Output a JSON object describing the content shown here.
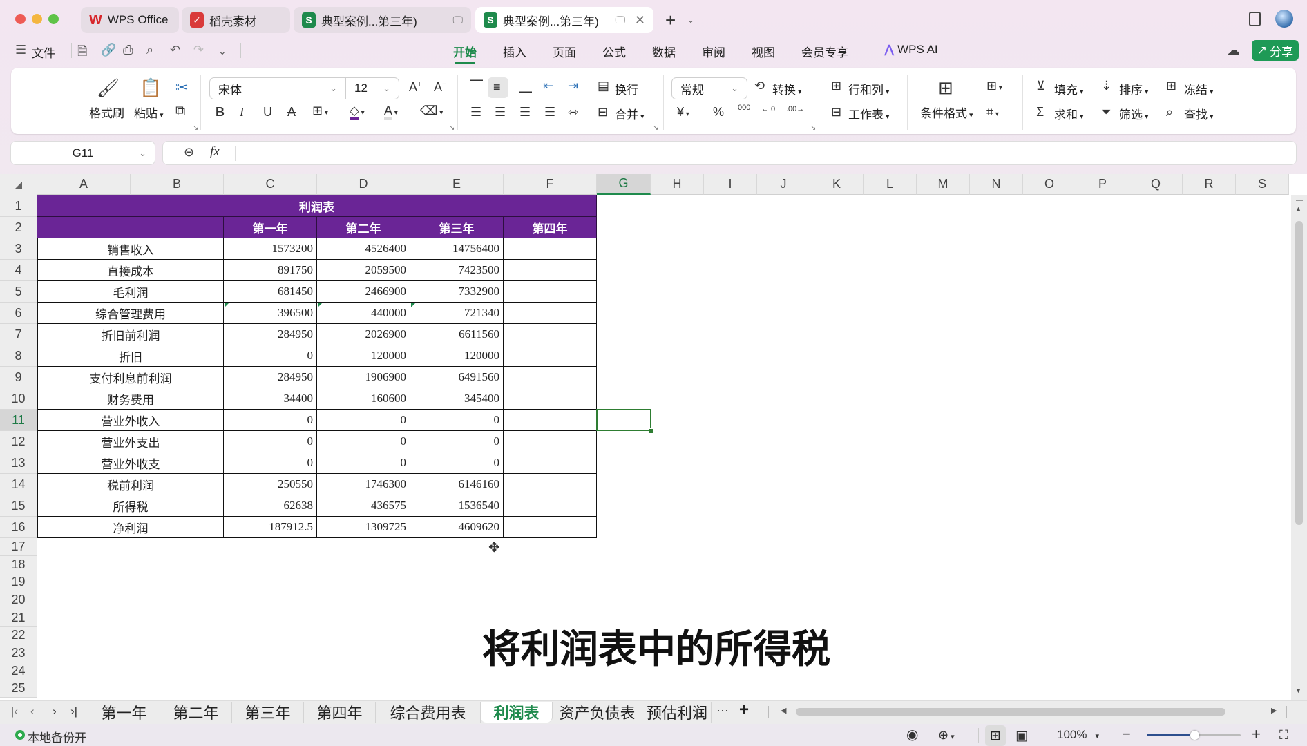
{
  "window": {
    "tabs": [
      {
        "label": "WPS Office",
        "icon": "wps-logo-icon",
        "active": false
      },
      {
        "label": "稻壳素材",
        "icon": "docer-icon",
        "active": false
      },
      {
        "label": "典型案例...第三年)",
        "icon": "spreadsheet-s-icon",
        "active": false
      },
      {
        "label": "典型案例...第三年)",
        "icon": "spreadsheet-s-icon",
        "active": true
      }
    ],
    "new_tab": "+",
    "colors": {
      "accent": "#1e8a4c",
      "header_fill": "#6a2596"
    }
  },
  "menu": {
    "file_label": "文件",
    "tabs": [
      "开始",
      "插入",
      "页面",
      "公式",
      "数据",
      "审阅",
      "视图",
      "会员专享"
    ],
    "active_tab": "开始",
    "ai_label": "WPS AI",
    "share_label": "分享"
  },
  "ribbon": {
    "format_painter": "格式刷",
    "paste": "粘贴",
    "font_name": "宋体",
    "font_size": "12",
    "wrap": "换行",
    "merge": "合并",
    "number_format": "常规",
    "convert": "转换",
    "rows_cols": "行和列",
    "worksheet": "工作表",
    "conditional_format": "条件格式",
    "fill": "填充",
    "sort": "排序",
    "freeze": "冻结",
    "sum": "求和",
    "filter": "筛选",
    "find": "查找",
    "currency_symbol": "¥",
    "percent": "%",
    "thousands": "000",
    "inc_decimal": "←.0",
    "dec_decimal": ".00→"
  },
  "formula_bar": {
    "name_box": "G11",
    "fx": "fx",
    "content": ""
  },
  "grid": {
    "columns": [
      "A",
      "B",
      "C",
      "D",
      "E",
      "F",
      "G",
      "H",
      "I",
      "J",
      "K",
      "L",
      "M",
      "N",
      "O",
      "P",
      "Q",
      "R",
      "S"
    ],
    "selected_column": "G",
    "rows": [
      "1",
      "2",
      "3",
      "4",
      "5",
      "6",
      "7",
      "8",
      "9",
      "10",
      "11",
      "12",
      "13",
      "14",
      "15",
      "16",
      "17",
      "18",
      "19",
      "20",
      "21",
      "22",
      "23",
      "24",
      "25"
    ],
    "selected_row": "11",
    "selected_cell": "G11"
  },
  "table": {
    "title": "利润表",
    "headers": [
      "",
      "第一年",
      "第二年",
      "第三年",
      "第四年"
    ],
    "rows": [
      {
        "label": "销售收入",
        "values": [
          "1573200",
          "4526400",
          "14756400",
          ""
        ]
      },
      {
        "label": "直接成本",
        "values": [
          "891750",
          "2059500",
          "7423500",
          ""
        ]
      },
      {
        "label": "毛利润",
        "values": [
          "681450",
          "2466900",
          "7332900",
          ""
        ]
      },
      {
        "label": "综合管理费用",
        "values": [
          "396500",
          "440000",
          "721340",
          ""
        ]
      },
      {
        "label": "折旧前利润",
        "values": [
          "284950",
          "2026900",
          "6611560",
          ""
        ]
      },
      {
        "label": "折旧",
        "values": [
          "0",
          "120000",
          "120000",
          ""
        ]
      },
      {
        "label": "支付利息前利润",
        "values": [
          "284950",
          "1906900",
          "6491560",
          ""
        ]
      },
      {
        "label": "财务费用",
        "values": [
          "34400",
          "160600",
          "345400",
          ""
        ]
      },
      {
        "label": "营业外收入",
        "values": [
          "0",
          "0",
          "0",
          ""
        ]
      },
      {
        "label": "营业外支出",
        "values": [
          "0",
          "0",
          "0",
          ""
        ]
      },
      {
        "label": "营业外收支",
        "values": [
          "0",
          "0",
          "0",
          ""
        ]
      },
      {
        "label": "税前利润",
        "values": [
          "250550",
          "1746300",
          "6146160",
          ""
        ]
      },
      {
        "label": "所得税",
        "values": [
          "62638",
          "436575",
          "1536540",
          ""
        ]
      },
      {
        "label": "净利润",
        "values": [
          "187912.5",
          "1309725",
          "4609620",
          ""
        ]
      }
    ]
  },
  "caption": "将利润表中的所得税",
  "sheet_tabs": {
    "tabs": [
      "第一年",
      "第二年",
      "第三年",
      "第四年",
      "综合费用表",
      "利润表",
      "资产负债表",
      "预估利润"
    ],
    "active": "利润表",
    "more": "···",
    "add": "+"
  },
  "status": {
    "backup": "本地备份开",
    "zoom": "100%",
    "zoom_level_percent": 100
  }
}
